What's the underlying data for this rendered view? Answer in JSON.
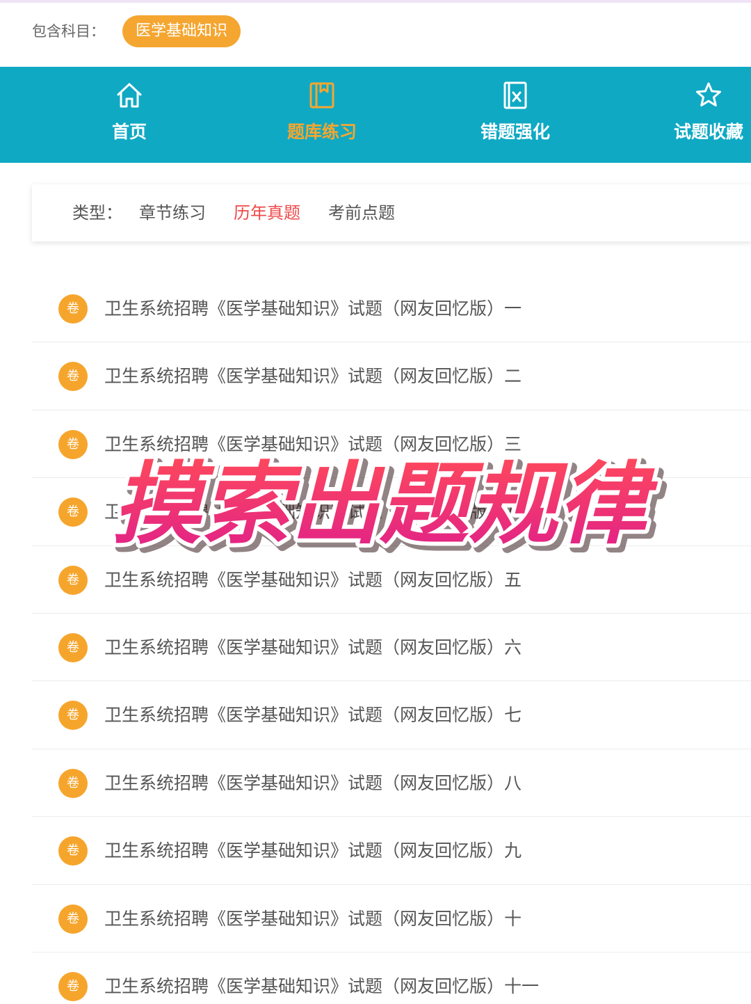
{
  "subject": {
    "label": "包含科目：",
    "selected": "医学基础知识"
  },
  "nav": {
    "items": [
      {
        "label": "首页",
        "icon": "home-icon"
      },
      {
        "label": "题库练习",
        "icon": "book-icon"
      },
      {
        "label": "错题强化",
        "icon": "wrong-question-icon"
      },
      {
        "label": "试题收藏",
        "icon": "star-icon"
      }
    ],
    "active_index": 1
  },
  "type_filter": {
    "label": "类型：",
    "options": [
      "章节练习",
      "历年真题",
      "考前点题"
    ],
    "active_index": 1
  },
  "papers": {
    "badge": "卷",
    "items": [
      "卫生系统招聘《医学基础知识》试题（网友回忆版）一",
      "卫生系统招聘《医学基础知识》试题（网友回忆版）二",
      "卫生系统招聘《医学基础知识》试题（网友回忆版）三",
      "卫生系统招聘《医学基础知识》试题（网友回忆版）四",
      "卫生系统招聘《医学基础知识》试题（网友回忆版）五",
      "卫生系统招聘《医学基础知识》试题（网友回忆版）六",
      "卫生系统招聘《医学基础知识》试题（网友回忆版）七",
      "卫生系统招聘《医学基础知识》试题（网友回忆版）八",
      "卫生系统招聘《医学基础知识》试题（网友回忆版）九",
      "卫生系统招聘《医学基础知识》试题（网友回忆版）十",
      "卫生系统招聘《医学基础知识》试题（网友回忆版）十一"
    ]
  },
  "overlay_text": "摸索出题规律",
  "colors": {
    "accent_orange": "#f5a630",
    "nav_teal": "#0fa9c4",
    "active_red": "#ee4a4a",
    "overlay_gradient_start": "#ff3a5c",
    "overlay_gradient_end": "#e0208a"
  }
}
